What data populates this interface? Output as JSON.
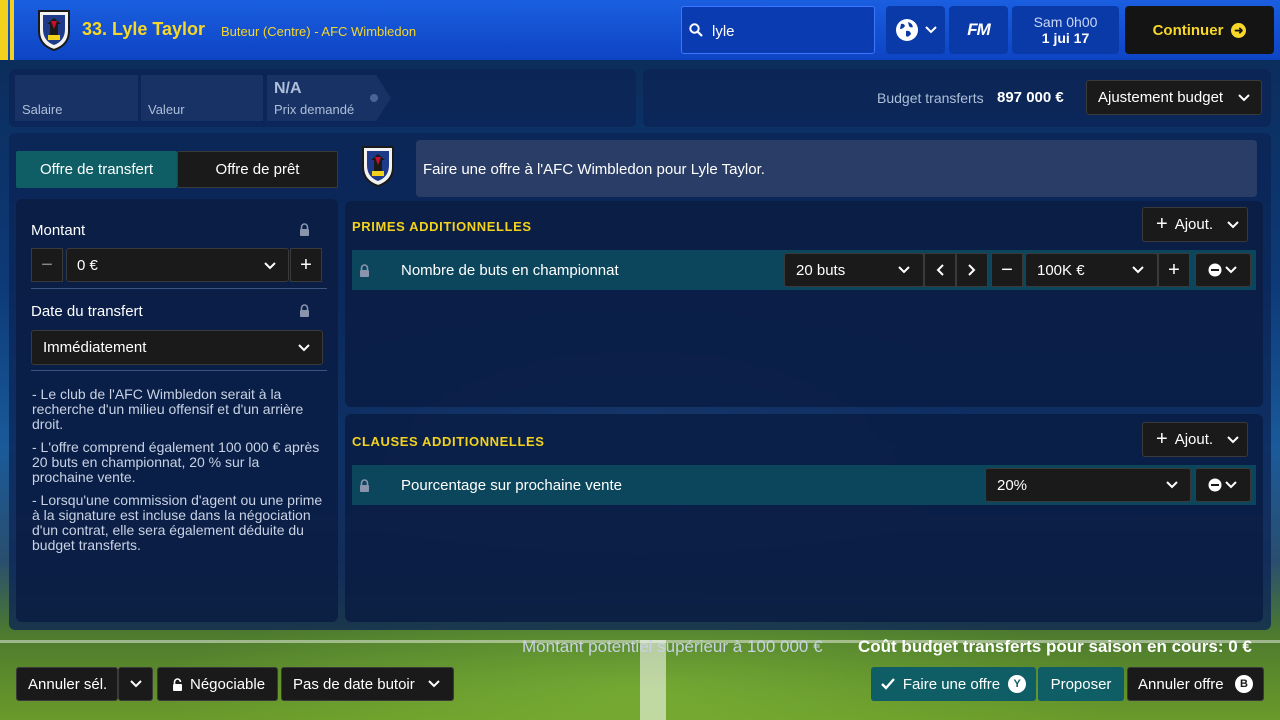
{
  "header": {
    "player_title": "33. Lyle Taylor",
    "player_subtitle": "Buteur (Centre) - AFC Wimbledon",
    "search_value": "lyle",
    "fm_label": "FM",
    "date_line1": "Sam 0h00",
    "date_line2": "1 jui 17",
    "continue_label": "Continuer"
  },
  "stats": {
    "salary_label": "Salaire",
    "value_label": "Valeur",
    "asking_value": "N/A",
    "asking_label": "Prix demandé"
  },
  "budget": {
    "label": "Budget transferts",
    "value": "897 000 €",
    "adjust_label": "Ajustement budget"
  },
  "tabs": {
    "transfer_offer": "Offre de transfert",
    "loan_offer": "Offre de prêt"
  },
  "message": "Faire une offre à l'AFC Wimbledon pour Lyle Taylor.",
  "left_form": {
    "amount_label": "Montant",
    "amount_value": "0 €",
    "minus": "−",
    "plus": "+",
    "date_label": "Date du transfert",
    "date_value": "Immédiatement"
  },
  "notes": [
    "- Le club de l'AFC Wimbledon serait à la recherche d'un milieu offensif et d'un arrière droit.",
    "-  L'offre comprend également 100 000 € après 20 buts en championnat, 20 % sur la prochaine vente.",
    "- Lorsqu'une commission d'agent ou une prime à la signature est incluse dans la négociation d'un contrat, elle sera également déduite du budget transferts."
  ],
  "bonuses": {
    "title": "PRIMES ADDITIONNELLES",
    "add_label": "Ajout.",
    "row": {
      "label": "Nombre de buts en championnat",
      "goals_value": "20 buts",
      "amount_value": "100K €",
      "minus": "−",
      "plus": "+"
    }
  },
  "clauses": {
    "title": "CLAUSES ADDITIONNELLES",
    "add_label": "Ajout.",
    "row": {
      "label": "Pourcentage sur prochaine vente",
      "value": "20%"
    }
  },
  "footer": {
    "potential_text": "Montant potentiel supérieur à 100 000 €",
    "cost_text": "Coût budget transferts pour saison en cours: 0 €",
    "cancel_sel": "Annuler sél.",
    "negotiable": "Négociable",
    "no_deadline": "Pas de date butoir",
    "make_offer": "Faire une offre",
    "make_offer_key": "Y",
    "propose": "Proposer",
    "cancel_offer": "Annuler offre",
    "cancel_offer_key": "B"
  },
  "colors": {
    "accent_yellow": "#f3d21d",
    "teal": "#0f5e66",
    "header_blue": "#0d44c4"
  }
}
